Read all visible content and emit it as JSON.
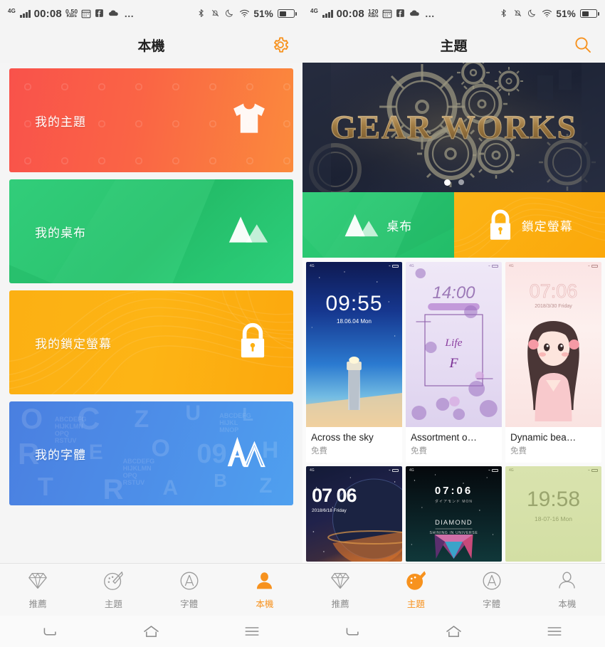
{
  "left": {
    "statusbar": {
      "network": "4G",
      "clock": "00:08",
      "speed_value": "0.50",
      "speed_unit": "KB/s",
      "battery_percent": "51%",
      "more": "…",
      "icons": [
        "calendar-icon",
        "facebook-icon",
        "cloud-icon",
        "bluetooth-icon",
        "mute-bell-icon",
        "moon-icon",
        "wifi-icon",
        "battery-icon"
      ]
    },
    "header": {
      "title": "本機",
      "action_icon": "gear-icon"
    },
    "cards": [
      {
        "label": "我的主題",
        "icon": "tshirt-icon",
        "color": "#fa5a48"
      },
      {
        "label": "我的桌布",
        "icon": "mountain-icon",
        "color": "#2ecc77"
      },
      {
        "label": "我的鎖定螢幕",
        "icon": "lock-icon",
        "color": "#fcb013"
      },
      {
        "label": "我的字體",
        "icon": "font-aa-icon",
        "color": "#4b87e4"
      }
    ],
    "tabs": [
      {
        "label": "推薦",
        "icon": "diamond-icon",
        "active": false
      },
      {
        "label": "主題",
        "icon": "palette-icon",
        "active": false
      },
      {
        "label": "字體",
        "icon": "letter-a-circle-icon",
        "active": false
      },
      {
        "label": "本機",
        "icon": "person-icon",
        "active": true
      }
    ]
  },
  "right": {
    "statusbar": {
      "network": "4G",
      "clock": "00:08",
      "speed_value": "120",
      "speed_unit": "KB/s",
      "battery_percent": "51%",
      "more": "…"
    },
    "header": {
      "title": "主題",
      "action_icon": "search-icon"
    },
    "banner": {
      "text": "GEAR WORKS",
      "page_count": 2,
      "active_page": 1
    },
    "categories": [
      {
        "label": "桌布",
        "icon": "mountain-icon",
        "color": "#2ecc77"
      },
      {
        "label": "鎖定螢幕",
        "icon": "lock-icon",
        "color": "#fcb415"
      }
    ],
    "themes": [
      {
        "name": "Across the sky",
        "price": "免費",
        "time": "09:55",
        "date": "18.06.04  Mon",
        "style": "th1"
      },
      {
        "name": "Assortment o…",
        "price": "免費",
        "time": "14:00",
        "date": "",
        "style": "th2"
      },
      {
        "name": "Dynamic bea…",
        "price": "免費",
        "time": "07:06",
        "date": "2018/3/30 Friday",
        "style": "th3"
      },
      {
        "name": "",
        "price": "",
        "time": "07 06",
        "date": "2018/6/18 Friday",
        "style": "th4"
      },
      {
        "name": "",
        "price": "",
        "time": "07:06",
        "date": "DIAMOND",
        "style": "th5"
      },
      {
        "name": "",
        "price": "",
        "time": "19:58",
        "date": "18-07-16  Mon",
        "style": "th6"
      }
    ],
    "tabs": [
      {
        "label": "推薦",
        "icon": "diamond-icon",
        "active": false
      },
      {
        "label": "主題",
        "icon": "palette-icon",
        "active": true
      },
      {
        "label": "字體",
        "icon": "letter-a-circle-icon",
        "active": false
      },
      {
        "label": "本機",
        "icon": "person-icon",
        "active": false
      }
    ]
  },
  "navbar": {
    "back": "back-icon",
    "home": "home-icon",
    "menu": "menu-icon"
  },
  "colors": {
    "accent": "#f7921e",
    "tab_inactive": "#8d8d8d"
  }
}
